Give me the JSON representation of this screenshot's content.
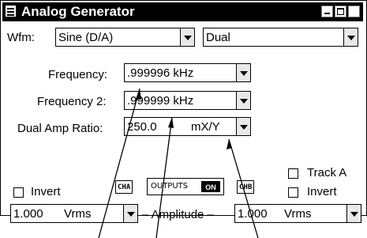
{
  "window": {
    "title": "Analog Generator"
  },
  "waveform": {
    "label": "Wfm:",
    "value": "Sine (D/A)",
    "mode": "Dual"
  },
  "frequency": {
    "label": "Frequency:",
    "value": ".999996 kHz"
  },
  "frequency2": {
    "label": "Frequency 2:",
    "value": ".999999 kHz"
  },
  "dual_amp_ratio": {
    "label": "Dual Amp Ratio:",
    "value": "250.0",
    "unit": "mX/Y"
  },
  "track_a": {
    "label": "Track A"
  },
  "invert_b": {
    "label": "Invert"
  },
  "invert_a": {
    "label": "Invert"
  },
  "channels": {
    "cha": "CHA",
    "chb": "CHB"
  },
  "outputs": {
    "label": "OUTPUTS",
    "state": "ON"
  },
  "amplitude": {
    "label": "– Amplitude –",
    "a_value": "1.000",
    "a_unit": "Vrms",
    "b_value": "1.000",
    "b_unit": "Vrms"
  }
}
